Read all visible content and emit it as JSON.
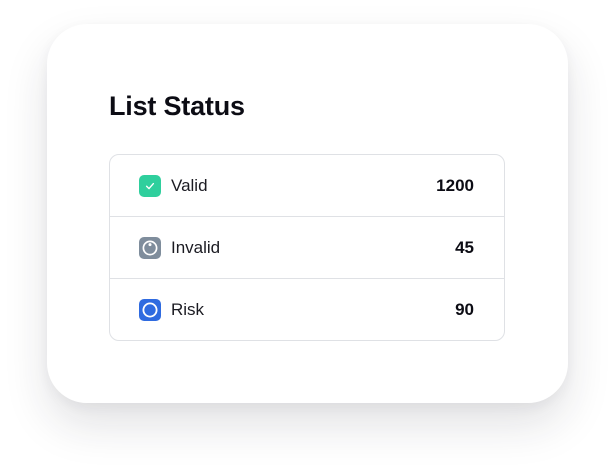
{
  "card": {
    "title": "List Status"
  },
  "rows": [
    {
      "label": "Valid",
      "value": "1200",
      "icon": "check-icon",
      "color": "#2fcf9d"
    },
    {
      "label": "Invalid",
      "value": "45",
      "icon": "circle-dot-icon",
      "color": "#7f8d9c"
    },
    {
      "label": "Risk",
      "value": "90",
      "icon": "circle-icon",
      "color": "#2f6be0"
    }
  ]
}
